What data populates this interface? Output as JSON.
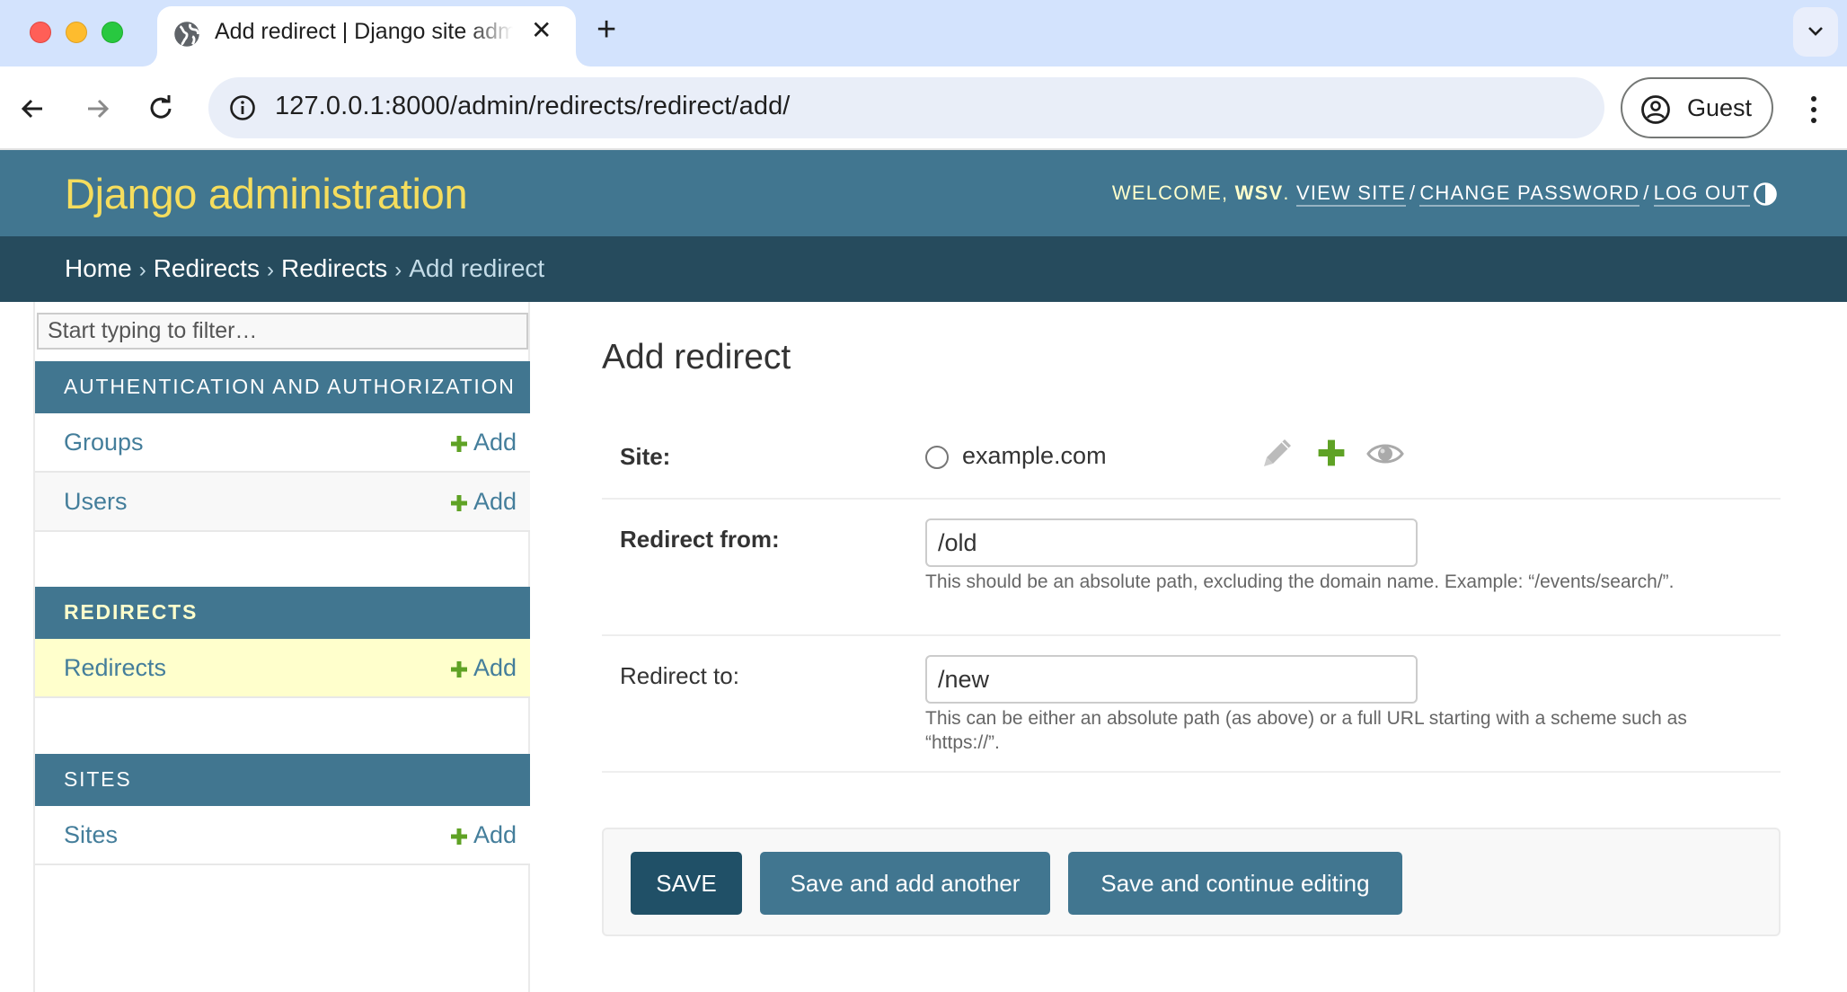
{
  "browser": {
    "tab_title": "Add redirect | Django site admin",
    "url": "127.0.0.1:8000/admin/redirects/redirect/add/",
    "profile_label": "Guest",
    "icons": {
      "tab_favicon": "globe-icon",
      "close": "close-icon",
      "new_tab": "plus-icon",
      "tab_search": "chevron-down-icon",
      "back": "arrow-left-icon",
      "forward": "arrow-right-icon",
      "reload": "reload-icon",
      "site_info": "info-icon",
      "profile": "account-circle-icon",
      "menu": "kebab-menu-icon"
    },
    "colors": {
      "tabbar_bg": "#d3e3fd",
      "omnibox_bg": "#e9eef8"
    }
  },
  "header": {
    "title": "Django administration",
    "welcome_prefix": "Welcome,",
    "username": "wsv",
    "links": {
      "view_site": "View site",
      "change_password": "Change password",
      "log_out": "Log out"
    },
    "theme_toggle_icon": "half-circle-contrast-icon",
    "colors": {
      "header_bg": "#417690",
      "brand_text": "#f5dd5d",
      "breadcrumbs_bg": "#264b5d"
    }
  },
  "breadcrumbs": {
    "items": [
      "Home",
      "Redirects",
      "Redirects"
    ],
    "current": "Add redirect",
    "separator": "›"
  },
  "sidebar": {
    "filter_placeholder": "Start typing to filter…",
    "add_label": "Add",
    "apps": [
      {
        "caption": "Authentication and Authorization",
        "active": false,
        "models": [
          {
            "name": "Groups",
            "current": false
          },
          {
            "name": "Users",
            "current": false
          }
        ]
      },
      {
        "caption": "Redirects",
        "active": true,
        "models": [
          {
            "name": "Redirects",
            "current": true
          }
        ]
      },
      {
        "caption": "Sites",
        "active": false,
        "models": [
          {
            "name": "Sites",
            "current": false
          }
        ]
      }
    ]
  },
  "form": {
    "title": "Add redirect",
    "fields": {
      "site": {
        "label": "Site:",
        "options": [
          {
            "label": "example.com",
            "selected": false
          }
        ],
        "related_icons": [
          "pencil-edit-icon",
          "plus-add-icon",
          "eye-view-icon"
        ]
      },
      "old_path": {
        "label": "Redirect from:",
        "value": "/old",
        "help_text": "This should be an absolute path, excluding the domain name. Example: “/events/search/”."
      },
      "new_path": {
        "label": "Redirect to:",
        "value": "/new",
        "help_text": "This can be either an absolute path (as above) or a full URL starting with a scheme such as “https://”."
      }
    },
    "buttons": {
      "save": "Save",
      "save_add_another": "Save and add another",
      "save_continue": "Save and continue editing"
    },
    "colors": {
      "primary_button": "#205067",
      "secondary_button": "#417690",
      "add_icon_green": "#5fa225"
    }
  }
}
